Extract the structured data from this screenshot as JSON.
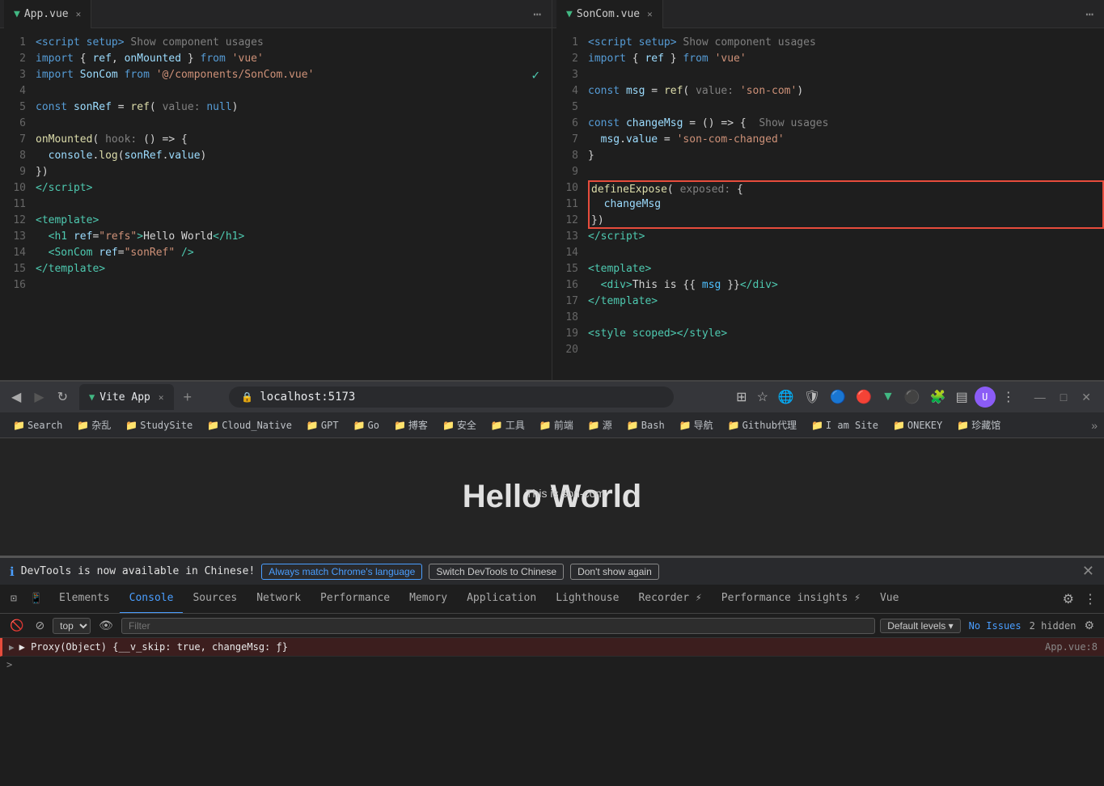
{
  "editor": {
    "tabs": [
      {
        "id": "app",
        "icon": "▼",
        "name": "App.vue",
        "active": true
      },
      {
        "id": "son",
        "icon": "▼",
        "name": "SonCom.vue",
        "active": true
      }
    ],
    "leftPane": {
      "lines": [
        {
          "num": 1,
          "code": "<kw>&lt;script setup&gt;</kw> <gray>Show component usages</gray>"
        },
        {
          "num": 2,
          "code": "<kw>import</kw> { <var>ref</var>, <var>onMounted</var> } <kw>from</kw> <str>'vue'</str>"
        },
        {
          "num": 3,
          "code": "<kw>import</kw> <var>SonCom</var> <kw>from</kw> <str>'@/components/SonCom.vue'</str>"
        },
        {
          "num": 4,
          "code": ""
        },
        {
          "num": 5,
          "code": "<kw>const</kw> <var>sonRef</var> = <fn>ref</fn>( <gray>value:</gray> <kw>null</kw>)"
        },
        {
          "num": 6,
          "code": ""
        },
        {
          "num": 7,
          "code": "<fn>onMounted</fn>( <gray>hook:</gray> () => {"
        },
        {
          "num": 8,
          "code": "  <var>console</var>.<fn>log</fn>(<var>sonRef</var>.<prop>value</prop>)"
        },
        {
          "num": 9,
          "code": "})"
        },
        {
          "num": 10,
          "code": "<tag>&lt;/script&gt;</tag>"
        },
        {
          "num": 11,
          "code": ""
        },
        {
          "num": 12,
          "code": "<tag>&lt;template&gt;</tag>"
        },
        {
          "num": 13,
          "code": "  <tag>&lt;h1</tag> <attr>ref</attr>=<str>\"refs\"</str><tag>&gt;</tag>Hello World<tag>&lt;/h1&gt;</tag>"
        },
        {
          "num": 14,
          "code": "  <tag>&lt;SonCom</tag> <attr>ref</attr>=<str>\"sonRef\"</str> <tag>/&gt;</tag>"
        },
        {
          "num": 15,
          "code": "<tag>&lt;/template&gt;</tag>"
        },
        {
          "num": 16,
          "code": ""
        }
      ]
    },
    "rightPane": {
      "lines": [
        {
          "num": 1,
          "code": "<kw>&lt;script setup&gt;</kw> <gray>Show component usages</gray>"
        },
        {
          "num": 2,
          "code": "<kw>import</kw> { <var>ref</var> } <kw>from</kw> <str>'vue'</str>"
        },
        {
          "num": 3,
          "code": ""
        },
        {
          "num": 4,
          "code": "<kw>const</kw> <var>msg</var> = <fn>ref</fn>( <gray>value:</gray> <str>'son-com'</str>)"
        },
        {
          "num": 5,
          "code": ""
        },
        {
          "num": 6,
          "code": "<kw>const</kw> <var>changeMsg</var> = () => {  <gray>Show usages</gray>"
        },
        {
          "num": 7,
          "code": "  <var>msg</var>.<prop>value</prop> = <str>'son-com-changed'</str>"
        },
        {
          "num": 8,
          "code": "}"
        },
        {
          "num": 9,
          "code": ""
        },
        {
          "num": 10,
          "code": "<fn>defineExpose</fn>( <gray>exposed:</gray> {",
          "highlight": true
        },
        {
          "num": 11,
          "code": "  <var>changeMsg</var>",
          "highlight": true
        },
        {
          "num": 12,
          "code": "})",
          "highlight": true
        },
        {
          "num": 13,
          "code": "<tag>&lt;/script&gt;</tag>"
        },
        {
          "num": 14,
          "code": ""
        },
        {
          "num": 15,
          "code": "<tag>&lt;template&gt;</tag>"
        },
        {
          "num": 16,
          "code": "  <tag>&lt;div&gt;</tag>This is {{ <blue2>msg</blue2> }}<tag>&lt;/div&gt;</tag>"
        },
        {
          "num": 17,
          "code": "<tag>&lt;/template&gt;</tag>"
        },
        {
          "num": 18,
          "code": ""
        },
        {
          "num": 19,
          "code": "<tag>&lt;style scoped&gt;&lt;/style&gt;</tag>"
        },
        {
          "num": 20,
          "code": ""
        }
      ]
    }
  },
  "browser": {
    "tab_label": "Vite App",
    "url": "localhost:5173",
    "webpage_text": "Hello World",
    "son_com_text": "This is son-com",
    "bookmarks": [
      "Search",
      "杂乱",
      "StudySite",
      "Cloud_Native",
      "GPT",
      "Go",
      "搏客",
      "安全",
      "工具",
      "前端",
      "源",
      "Bash",
      "导航",
      "Github代理",
      "I am Site",
      "ONEKEY",
      "珍藏馆"
    ]
  },
  "devtools": {
    "banner_text": "DevTools is now available in Chinese!",
    "btn1": "Always match Chrome's language",
    "btn2": "Switch DevTools to Chinese",
    "btn3": "Don't show again",
    "tabs": [
      "Elements",
      "Console",
      "Sources",
      "Network",
      "Performance",
      "Memory",
      "Application",
      "Lighthouse",
      "Recorder ⚡",
      "Performance insights ⚡",
      "Vue"
    ],
    "active_tab": "Console",
    "toolbar": {
      "top_label": "top",
      "filter_placeholder": "Filter",
      "levels_label": "Default levels ▾",
      "issues_label": "No Issues",
      "hidden_label": "2 hidden"
    },
    "console_line": "▶ Proxy(Object) {__v_skip: true, changeMsg: ƒ}",
    "file_ref": "App.vue:8",
    "prompt": ">"
  }
}
